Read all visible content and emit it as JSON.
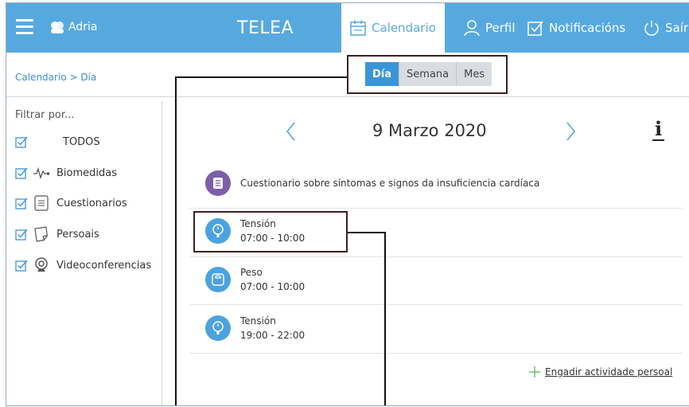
{
  "header": {
    "user_name": "Adria",
    "app_title": "TELEA",
    "nav": [
      {
        "label": "Calendario",
        "icon": "calendar-icon",
        "active": true
      },
      {
        "label": "Perfil",
        "icon": "user-icon",
        "active": false
      },
      {
        "label": "Notificacións",
        "icon": "check-square-icon",
        "active": false
      },
      {
        "label": "Saír",
        "icon": "power-icon",
        "active": false
      }
    ]
  },
  "breadcrumb": "Calendario > Día",
  "views": [
    {
      "label": "Día",
      "active": true
    },
    {
      "label": "Semana",
      "active": false
    },
    {
      "label": "Mes",
      "active": false
    }
  ],
  "sidebar": {
    "title": "Filtrar por...",
    "filters": [
      {
        "label": "TODOS",
        "checked": true,
        "icon": ""
      },
      {
        "label": "Biomedidas",
        "checked": true,
        "icon": "pulse-icon"
      },
      {
        "label": "Cuestionarios",
        "checked": true,
        "icon": "document-icon"
      },
      {
        "label": "Persoais",
        "checked": true,
        "icon": "note-icon"
      },
      {
        "label": "Videoconferencias",
        "checked": true,
        "icon": "webcam-icon"
      }
    ]
  },
  "day": {
    "date": "9 Marzo 2020",
    "info_label": "i"
  },
  "events": [
    {
      "title": "Cuestionario sobre síntomas e signos da insuficiencia cardíaca",
      "time": "",
      "icon": "questionnaire-icon",
      "color": "#7b5ea7"
    },
    {
      "title": "Tensión",
      "time": "07:00 - 10:00",
      "icon": "blood-pressure-icon",
      "color": "#4aa3df"
    },
    {
      "title": "Peso",
      "time": "07:00 - 10:00",
      "icon": "scale-icon",
      "color": "#4aa3df"
    },
    {
      "title": "Tensión",
      "time": "19:00 - 22:00",
      "icon": "blood-pressure-icon",
      "color": "#4aa3df"
    }
  ],
  "add_activity_label": "Engadir actividade persoal",
  "colors": {
    "topbar": "#56a9df",
    "accent": "#3a95d8",
    "questionnaire": "#7b5ea7",
    "callout": "#3b1f1f"
  }
}
